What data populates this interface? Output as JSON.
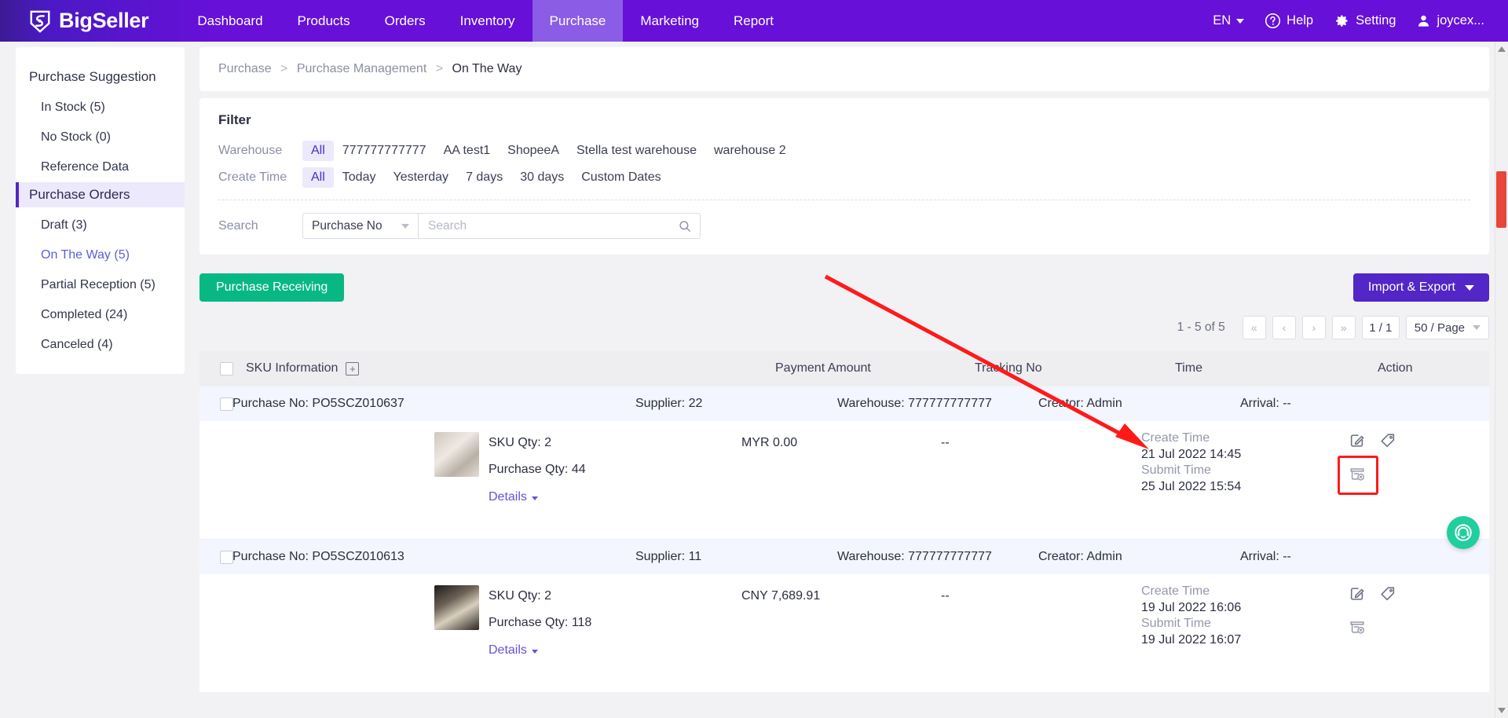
{
  "header": {
    "brand": "BigSeller",
    "nav": [
      {
        "label": "Dashboard",
        "active": false
      },
      {
        "label": "Products",
        "active": false
      },
      {
        "label": "Orders",
        "active": false
      },
      {
        "label": "Inventory",
        "active": false
      },
      {
        "label": "Purchase",
        "active": true
      },
      {
        "label": "Marketing",
        "active": false
      },
      {
        "label": "Report",
        "active": false
      }
    ],
    "language": "EN",
    "help": "Help",
    "setting": "Setting",
    "user": "joycex...",
    "brand_color": "#6610d8",
    "active_nav_color": "#8b5ce6"
  },
  "sidebar": {
    "groups": [
      {
        "label": "Purchase Suggestion",
        "selected": false
      },
      {
        "label": "Purchase Orders",
        "selected": true
      }
    ],
    "suggestion_items": [
      {
        "label": "In Stock (5)",
        "linked": false
      },
      {
        "label": "No Stock (0)",
        "linked": false
      },
      {
        "label": "Reference Data",
        "linked": false
      }
    ],
    "order_items": [
      {
        "label": "Draft (3)",
        "linked": false
      },
      {
        "label": "On The Way (5)",
        "linked": true
      },
      {
        "label": "Partial Reception (5)",
        "linked": false
      },
      {
        "label": "Completed (24)",
        "linked": false
      },
      {
        "label": "Canceled (4)",
        "linked": false
      }
    ]
  },
  "breadcrumb": {
    "root": "Purchase",
    "mid": "Purchase Management",
    "current": "On The Way",
    "sep": ">"
  },
  "filter": {
    "title": "Filter",
    "warehouse_label": "Warehouse",
    "warehouse_options": [
      "All",
      "777777777777",
      "AA test1",
      "ShopeeA",
      "Stella test warehouse",
      "warehouse 2"
    ],
    "warehouse_selected": "All",
    "create_time_label": "Create Time",
    "create_time_options": [
      "All",
      "Today",
      "Yesterday",
      "7 days",
      "30 days",
      "Custom Dates"
    ],
    "create_time_selected": "All",
    "search_label": "Search",
    "search_field": "Purchase No",
    "search_placeholder": "Search",
    "search_value": ""
  },
  "toolbar": {
    "receiving_label": "Purchase Receiving",
    "import_export_label": "Import & Export",
    "green": "#08b882",
    "purple": "#5226c7"
  },
  "pagination": {
    "count": "1 - 5 of 5",
    "first": "«",
    "prev": "‹",
    "next": "›",
    "last": "»",
    "page": "1 / 1",
    "page_size": "50 / Page"
  },
  "table": {
    "columns": [
      "SKU Information",
      "Payment Amount",
      "Tracking No",
      "Time",
      "Action"
    ],
    "rows": [
      {
        "purchase_no_label": "Purchase No:",
        "purchase_no": "PO5SCZ010637",
        "supplier": "Supplier: 22",
        "warehouse": "Warehouse: 777777777777",
        "creator": "Creator: Admin",
        "arrival": "Arrival: --",
        "sku_qty": "SKU Qty: 2",
        "purchase_qty": "Purchase Qty: 44",
        "details": "Details",
        "payment_amount": "MYR 0.00",
        "tracking_no": "--",
        "create_time_label": "Create Time",
        "create_time": "21 Jul 2022 14:45",
        "submit_time_label": "Submit Time",
        "submit_time": "25 Jul 2022 15:54",
        "highlighted_action": true
      },
      {
        "purchase_no_label": "Purchase No:",
        "purchase_no": "PO5SCZ010613",
        "supplier": "Supplier: 11",
        "warehouse": "Warehouse: 777777777777",
        "creator": "Creator: Admin",
        "arrival": "Arrival: --",
        "sku_qty": "SKU Qty: 2",
        "purchase_qty": "Purchase Qty: 118",
        "details": "Details",
        "payment_amount": "CNY 7,689.91",
        "tracking_no": "--",
        "create_time_label": "Create Time",
        "create_time": "19 Jul 2022 16:06",
        "submit_time_label": "Submit Time",
        "submit_time": "19 Jul 2022 16:07",
        "highlighted_action": false
      }
    ]
  },
  "annotation": {
    "arrow_color": "#ff1a1a",
    "highlight_color": "#ff1a1a"
  },
  "icons": {
    "help": "question-circle-icon",
    "setting": "gear-icon",
    "user": "user-icon",
    "search": "search-icon",
    "edit": "edit-icon",
    "tag": "tag-icon",
    "cancel_order": "cancel-order-icon",
    "chat": "headset-chat-icon"
  }
}
